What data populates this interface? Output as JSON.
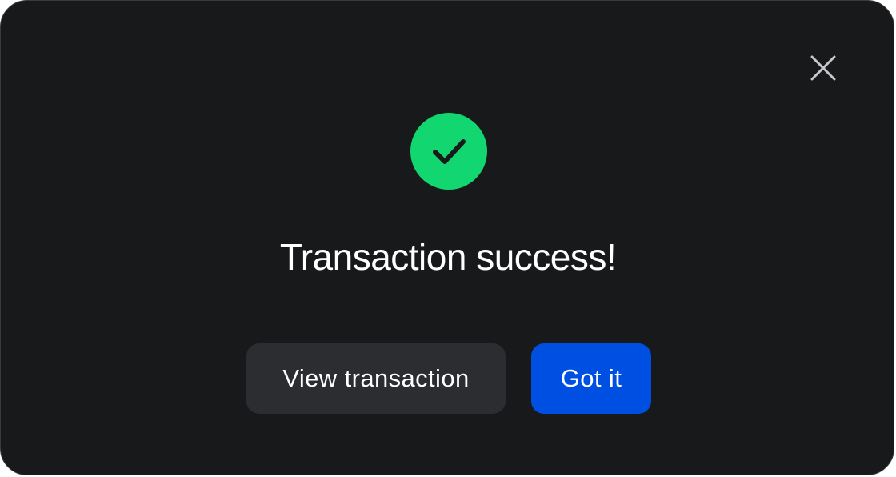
{
  "dialog": {
    "title": "Transaction success!",
    "close_icon": "close-icon",
    "status_icon": "check-circle-icon",
    "secondary_button_label": "View transaction",
    "primary_button_label": "Got it"
  },
  "colors": {
    "background": "#18191b",
    "success": "#12d66f",
    "primary": "#004fe3",
    "secondary": "#2c2d30",
    "text": "#ffffff",
    "close_icon": "#c7c8cc"
  }
}
